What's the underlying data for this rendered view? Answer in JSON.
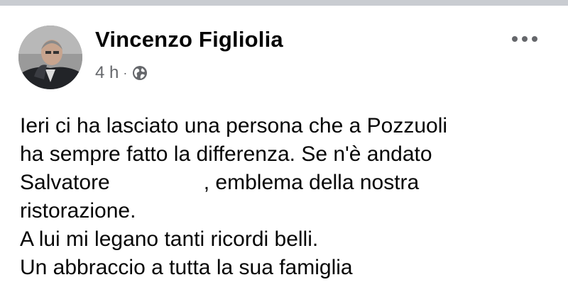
{
  "post": {
    "author": "Vincenzo Figliolia",
    "timestamp": "4 h",
    "separator": "·",
    "audience_icon": "globe-icon",
    "more_icon": "more-options-icon",
    "text_lines": {
      "l1": "Ieri ci ha lasciato una persona che a Pozzuoli",
      "l2": "ha sempre fatto la differenza. Se n'è andato",
      "l3_before": "Salvatore",
      "l3_after": ", emblema della nostra",
      "l4": "ristorazione.",
      "l5": "A lui mi legano tanti ricordi belli.",
      "l6": "Un abbraccio a tutta la sua famiglia"
    }
  },
  "colors": {
    "text": "#050505",
    "secondary_text": "#65676b",
    "top_strip": "#c9ccd1"
  }
}
